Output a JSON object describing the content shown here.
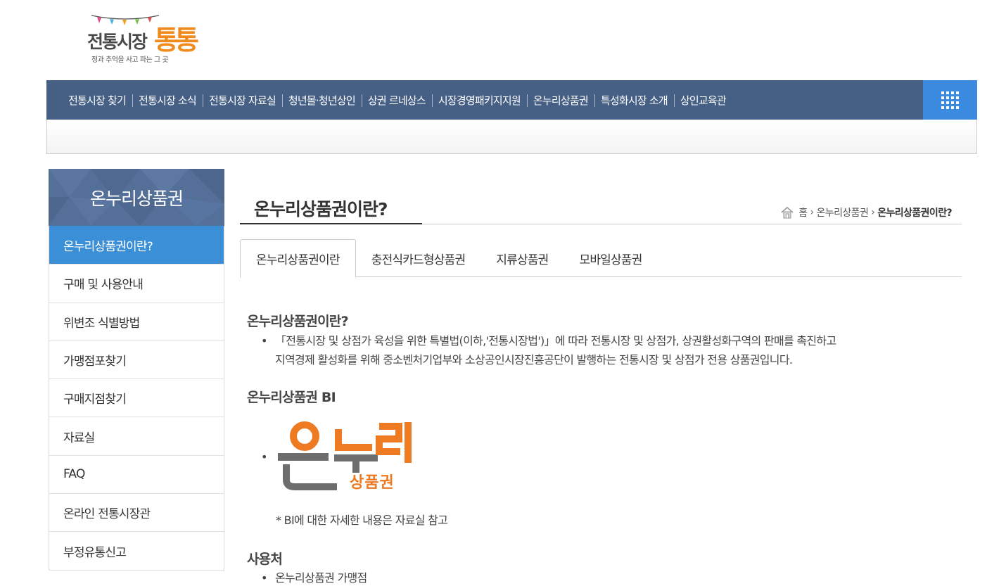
{
  "logo": {
    "title": "전통시장",
    "accent": "통통",
    "tagline": "정과 추억을 사고 파는 그 곳"
  },
  "gnb": {
    "items": [
      "전통시장 찾기",
      "전통시장 소식",
      "전통시장 자료실",
      "청년몰·청년상인",
      "상권 르네상스",
      "시장경영패키지지원",
      "온누리상품권",
      "특성화시장 소개",
      "상인교육관"
    ],
    "all_menu_icon": "grid-menu-icon"
  },
  "lnb": {
    "title": "온누리상품권",
    "items": [
      "온누리상품권이란?",
      "구매 및 사용안내",
      "위변조 식별방법",
      "가맹점포찾기",
      "구매지점찾기",
      "자료실",
      "FAQ",
      "온라인 전통시장관",
      "부정유통신고"
    ],
    "active_index": 0
  },
  "page": {
    "title": "온누리상품권이란?",
    "breadcrumb": {
      "home": "홈",
      "level1": "온누리상품권",
      "current": "온누리상품권이란?"
    }
  },
  "tabs": [
    "온누리상품권이란",
    "충전식카드형상품권",
    "지류상품권",
    "모바일상품권"
  ],
  "content": {
    "section1_title": "온누리상품권이란?",
    "section1_line1": "「전통시장 및 상점가 육성을 위한 특별법(이하,'전통시장법')」에 따라 전통시장 및 상점가, 상권활성화구역의 판매를 촉진하고",
    "section1_line2": "지역경제 활성화를 위해 중소벤처기업부와 소상공인시장진흥공단이 발행하는 전통시장 및 상점가 전용 상품권입니다.",
    "section2_title": "온누리상품권 BI",
    "bi_logo_main": "온누리",
    "bi_logo_sub": "상품권",
    "bi_bullet": "•",
    "bi_note": "* BI에 대한 자세한 내용은 자료실 참고",
    "section3_title": "사용처",
    "section3_item1": "온누리상품권 가맹점"
  },
  "colors": {
    "gnb_bg": "#465f85",
    "accent_blue": "#3a8fd6",
    "lnb_head": "#546f98",
    "brand_orange": "#ee7a22",
    "brand_gray": "#6d6d6d"
  }
}
